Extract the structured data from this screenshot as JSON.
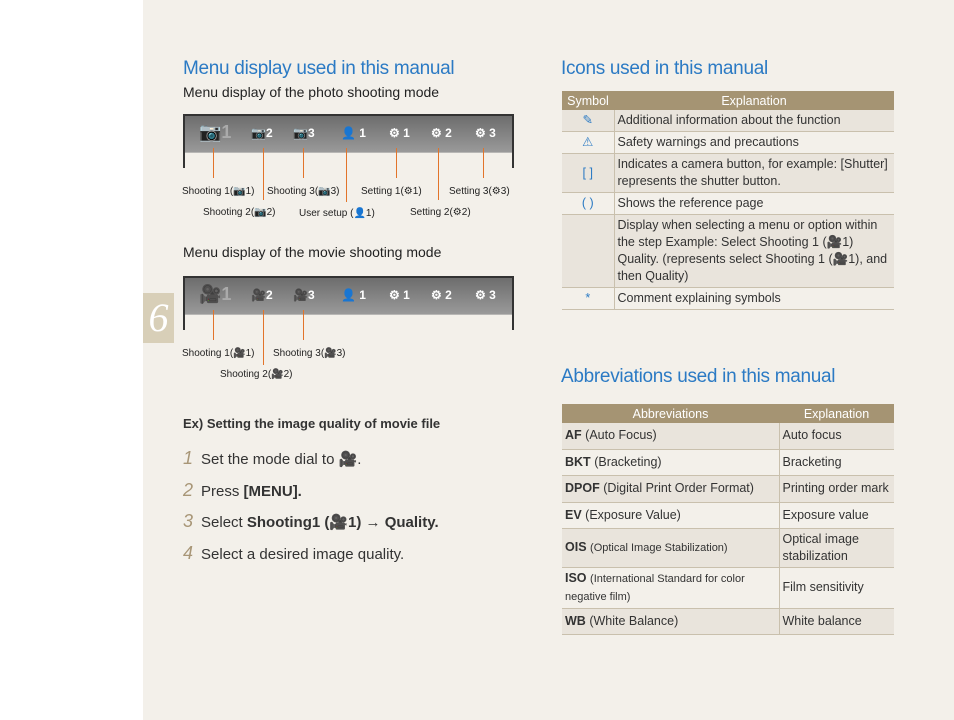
{
  "page_number": "6",
  "menu_section": {
    "title": "Menu display used in this manual",
    "photo_subtitle": "Menu display of the photo shooting mode",
    "movie_subtitle": "Menu display of the movie shooting mode",
    "photo_tabs": [
      "1",
      "2",
      "3",
      "1",
      "1",
      "2",
      "3"
    ],
    "photo_labels": [
      "Shooting 1(📷1)",
      "Shooting 2(📷2)",
      "Shooting 3(📷3)",
      "User setup (👤1)",
      "Setting 1(⚙1)",
      "Setting 2(⚙2)",
      "Setting 3(⚙3)"
    ],
    "movie_labels": [
      "Shooting 1(🎥1)",
      "Shooting 2(🎥2)",
      "Shooting 3(🎥3)"
    ],
    "example_title": "Ex) Setting the image quality of movie file",
    "steps": [
      {
        "n": "1",
        "text": "Set the mode dial to 🎥."
      },
      {
        "n": "2",
        "text": "Press ",
        "bold": "[MENU]."
      },
      {
        "n": "3",
        "text": "Select ",
        "bold": "Shooting1 (🎥1) → Quality."
      },
      {
        "n": "4",
        "text": "Select a desired image quality."
      }
    ]
  },
  "icons_section": {
    "title": "Icons used in this manual",
    "headers": [
      "Symbol",
      "Explanation"
    ],
    "rows": [
      {
        "symbol": "note-icon",
        "text": "Additional information about the function"
      },
      {
        "symbol": "warning-icon",
        "text": "Safety warnings and precautions"
      },
      {
        "symbol": "[ ]",
        "text": "Indicates a camera button, for example: [Shutter] represents the shutter button."
      },
      {
        "symbol": "( )",
        "text": "Shows the reference page"
      },
      {
        "symbol": "",
        "text": "Display when selecting a menu or option within the step Example: Select Shooting 1 (🎥1) Quality. (represents select Shooting 1 (🎥1), and then Quality)"
      },
      {
        "symbol": "*",
        "text": "Comment explaining symbols"
      }
    ]
  },
  "abbr_section": {
    "title": "Abbreviations used in this manual",
    "headers": [
      "Abbreviations",
      "Explanation"
    ],
    "rows": [
      {
        "abbr": "AF",
        "full": "(Auto  Focus)",
        "exp": "Auto focus"
      },
      {
        "abbr": "BKT",
        "full": "(Bracketing)",
        "exp": "Bracketing"
      },
      {
        "abbr": "DPOF",
        "full": "(Digital  Print  Order  Format)",
        "exp": "Printing order mark"
      },
      {
        "abbr": "EV",
        "full": "(Exposure  Value)",
        "exp": "Exposure value"
      },
      {
        "abbr": "OIS",
        "full": "(Optical  Image  Stabilization)",
        "exp": "Optical image stabilization"
      },
      {
        "abbr": "ISO",
        "full": "(International Standard for color negative  film)",
        "exp": "Film sensitivity"
      },
      {
        "abbr": "WB",
        "full": "(White  Balance)",
        "exp": "White balance"
      }
    ]
  },
  "colors": {
    "heading": "#2b7ac4",
    "table_header": "#a59473",
    "accent_line": "#e2742a",
    "tab": "#d8cfb8"
  }
}
